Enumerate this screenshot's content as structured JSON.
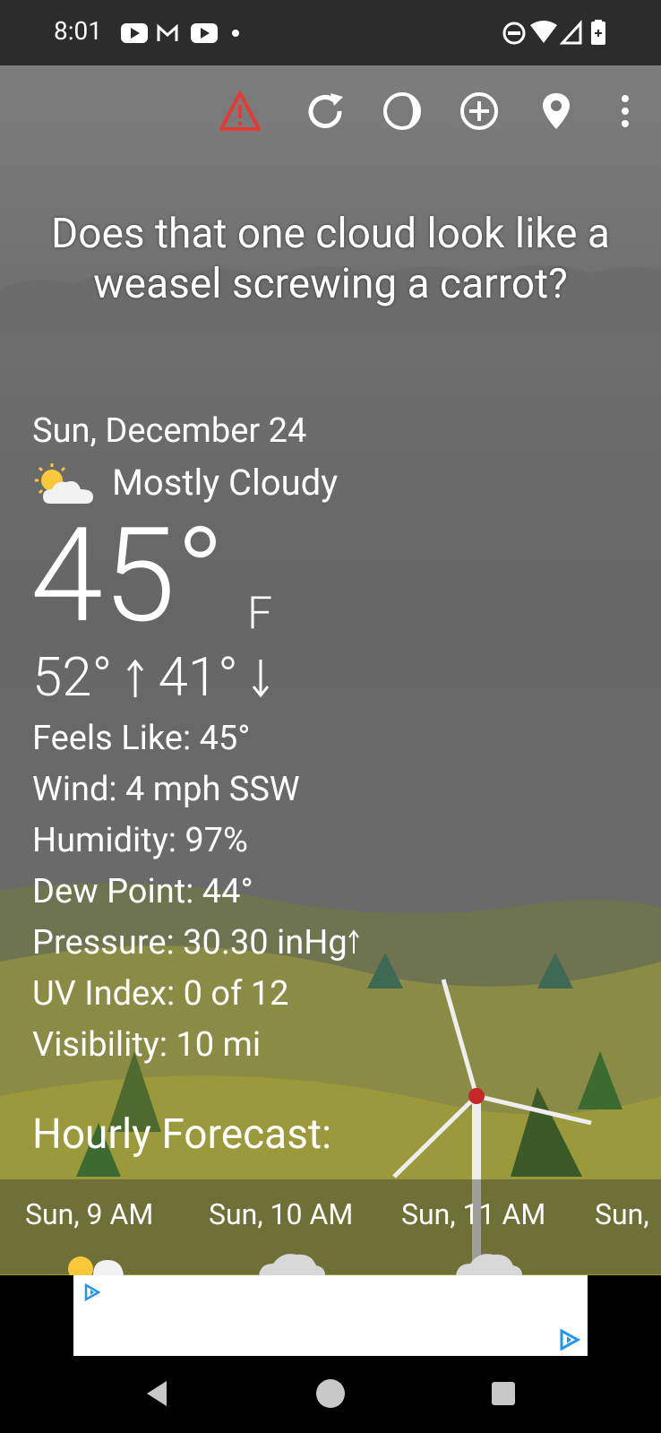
{
  "status_bar": {
    "time": "8:01"
  },
  "toolbar": {
    "alert_icon": "warning-icon",
    "refresh_icon": "refresh-icon",
    "theme_icon": "moon-phase-icon",
    "add_icon": "add-location-icon",
    "location_icon": "map-pin-icon",
    "menu_icon": "overflow-menu-icon",
    "alert_color": "#e53935"
  },
  "headline": {
    "line1": "Does that one cloud look like a",
    "line2": "weasel screwing a carrot?"
  },
  "current": {
    "date": "Sun, December 24",
    "condition": "Mostly Cloudy",
    "temperature": "45°",
    "unit": "F",
    "high": "52°",
    "low": "41°"
  },
  "details": {
    "feels_like": "Feels Like:  45°",
    "wind": "Wind:  4 mph SSW",
    "humidity": "Humidity:  97%",
    "dew_point": "Dew Point:  44°",
    "pressure": "Pressure:  30.30 inHg",
    "uv_index": "UV Index:  0 of 12",
    "visibility": "Visibility:  10 mi"
  },
  "hourly": {
    "title": "Hourly Forecast:",
    "hours": [
      "Sun, 9 AM",
      "Sun, 10 AM",
      "Sun, 11 AM",
      "Sun,"
    ]
  }
}
